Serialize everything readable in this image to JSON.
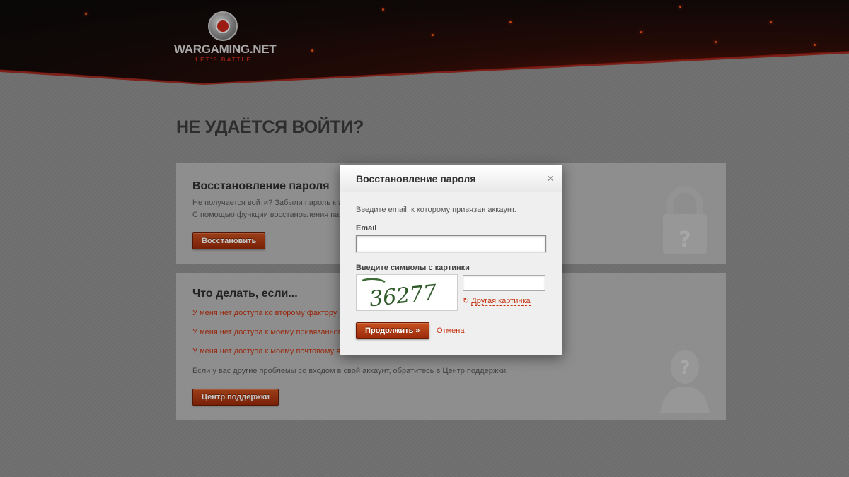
{
  "header": {
    "logo_name": "WARGAMING.NET",
    "logo_tagline": "LET'S BATTLE"
  },
  "page": {
    "title": "НЕ УДАЁТСЯ ВОЙТИ?",
    "recovery_card": {
      "title": "Восстановление пароля",
      "line1": "Не получается войти? Забыли пароль к а",
      "line2": "С помощью функции восстановления пар",
      "button": "Восстановить"
    },
    "help_card": {
      "title": "Что делать, если...",
      "links": [
        "У меня нет доступа ко второму фактору з",
        "У меня нет доступа к моему привязанном",
        "У меня нет доступа к моему почтовому я"
      ],
      "note": "Если у вас другие проблемы со входом в свой аккаунт, обратитесь в Центр поддержки.",
      "button": "Центр поддержки"
    }
  },
  "modal": {
    "title": "Восстановление пароля",
    "close": "×",
    "description": "Введите email, к которому привязан аккаунт.",
    "email_label": "Email",
    "email_value": "",
    "captcha_label": "Введите символы с картинки",
    "captcha_text": "36277",
    "captcha_value": "",
    "refresh_label": "Другая картинка",
    "submit": "Продолжить »",
    "cancel": "Отмена"
  },
  "colors": {
    "accent": "#c43411",
    "button": "#b23a14"
  }
}
